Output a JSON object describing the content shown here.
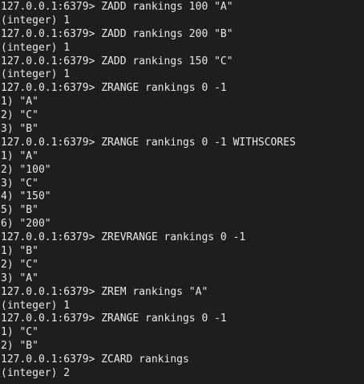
{
  "terminal": {
    "lines": [
      "127.0.0.1:6379> ZADD rankings 100 \"A\"",
      "(integer) 1",
      "127.0.0.1:6379> ZADD rankings 200 \"B\"",
      "(integer) 1",
      "127.0.0.1:6379> ZADD rankings 150 \"C\"",
      "(integer) 1",
      "127.0.0.1:6379> ZRANGE rankings 0 -1",
      "1) \"A\"",
      "2) \"C\"",
      "3) \"B\"",
      "127.0.0.1:6379> ZRANGE rankings 0 -1 WITHSCORES",
      "1) \"A\"",
      "2) \"100\"",
      "3) \"C\"",
      "4) \"150\"",
      "5) \"B\"",
      "6) \"200\"",
      "127.0.0.1:6379> ZREVRANGE rankings 0 -1",
      "1) \"B\"",
      "2) \"C\"",
      "3) \"A\"",
      "127.0.0.1:6379> ZREM rankings \"A\"",
      "(integer) 1",
      "127.0.0.1:6379> ZRANGE rankings 0 -1",
      "1) \"C\"",
      "2) \"B\"",
      "127.0.0.1:6379> ZCARD rankings",
      "(integer) 2"
    ]
  }
}
